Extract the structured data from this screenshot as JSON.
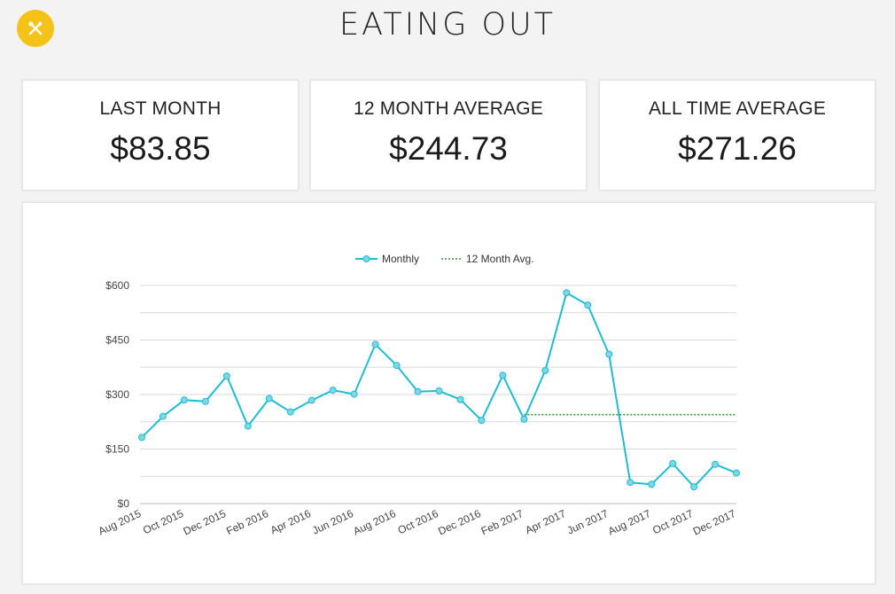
{
  "header": {
    "title": "EATING OUT",
    "logo_icon": "fork-knife-icon",
    "logo_color": "#f5c317"
  },
  "stats": [
    {
      "label": "LAST MONTH",
      "value": "$83.85"
    },
    {
      "label": "12 MONTH AVERAGE",
      "value": "$244.73"
    },
    {
      "label": "ALL TIME AVERAGE",
      "value": "$271.26"
    }
  ],
  "chart_data": {
    "type": "line",
    "legend_position": "top-center",
    "grid": true,
    "ylim": [
      0,
      600
    ],
    "y_ticks": [
      {
        "value": 0,
        "label": "$0"
      },
      {
        "value": 150,
        "label": "$150"
      },
      {
        "value": 300,
        "label": "$300"
      },
      {
        "value": 450,
        "label": "$450"
      },
      {
        "value": 600,
        "label": "$600"
      }
    ],
    "x": [
      "Aug 2015",
      "Sep 2015",
      "Oct 2015",
      "Nov 2015",
      "Dec 2015",
      "Jan 2016",
      "Feb 2016",
      "Mar 2016",
      "Apr 2016",
      "May 2016",
      "Jun 2016",
      "Jul 2016",
      "Aug 2016",
      "Sep 2016",
      "Oct 2016",
      "Nov 2016",
      "Dec 2016",
      "Jan 2017",
      "Feb 2017",
      "Mar 2017",
      "Apr 2017",
      "May 2017",
      "Jun 2017",
      "Jul 2017",
      "Aug 2017",
      "Sep 2017",
      "Oct 2017",
      "Nov 2017",
      "Dec 2017"
    ],
    "x_tick_labels": [
      "Aug 2015",
      "Oct 2015",
      "Dec 2015",
      "Feb 2016",
      "Apr 2016",
      "Jun 2016",
      "Aug 2016",
      "Oct 2016",
      "Dec 2016",
      "Feb 2017",
      "Apr 2017",
      "Jun 2017",
      "Aug 2017",
      "Oct 2017",
      "Dec 2017"
    ],
    "series": [
      {
        "name": "Monthly",
        "color": "#1fbcd2",
        "style": "solid",
        "values": [
          182,
          240,
          285,
          281,
          351,
          213,
          289,
          252,
          284,
          312,
          301,
          438,
          380,
          308,
          310,
          286,
          229,
          353,
          232,
          366,
          580,
          546,
          411,
          58,
          53,
          110,
          46,
          108,
          84
        ]
      },
      {
        "name": "12 Month Avg.",
        "color": "#2a9a2a",
        "style": "dotted",
        "start_x": "Feb 2017",
        "end_x": "Dec 2017",
        "value": 244.73
      }
    ]
  }
}
